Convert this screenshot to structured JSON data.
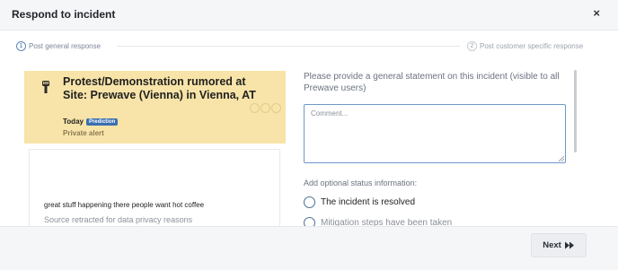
{
  "modal": {
    "title": "Respond to incident",
    "close_icon": "×"
  },
  "steps": [
    {
      "number": "1",
      "label": "Post general response",
      "active": true
    },
    {
      "number": "2",
      "label": "Post customer specific response",
      "active": false
    }
  ],
  "alert": {
    "title": "Protest/Demonstration rumored at Site: Prewave (Vienna) in Vienna, AT",
    "date": "Today",
    "badge": "Prediction",
    "visibility": "Private alert",
    "icon": "protest-fist-icon"
  },
  "source": {
    "text": "great stuff happening there people want hot coffee",
    "note": "Source retracted for data privacy reasons"
  },
  "form": {
    "prompt": "Please provide a general statement on this incident (visible to all Prewave users)",
    "comment_placeholder": "Comment...",
    "comment_value": "",
    "status_label": "Add optional status information:",
    "options": [
      {
        "label": "The incident is resolved"
      },
      {
        "label": "Mitigation steps have been taken"
      }
    ]
  },
  "footer": {
    "next_label": "Next"
  },
  "colors": {
    "accent": "#3a6fb0",
    "alert_bg": "#f8e4a8",
    "input_border": "#6f98c9"
  }
}
